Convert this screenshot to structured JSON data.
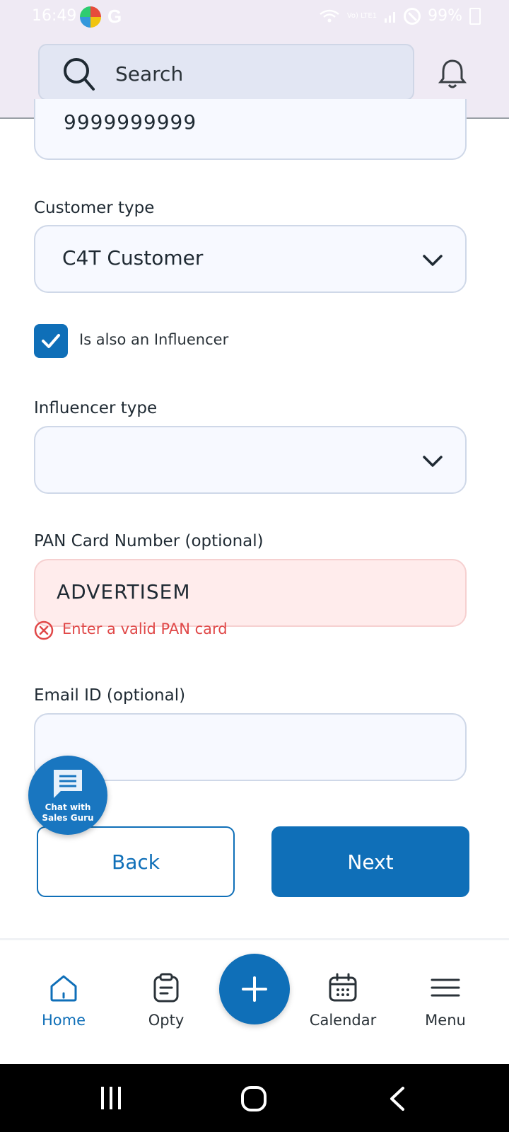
{
  "status_bar": {
    "time": "16:49",
    "network": "Vo) LTE1",
    "battery": "99%"
  },
  "header": {
    "search_placeholder": "Search"
  },
  "form": {
    "phone_value": "9999999999",
    "customer_type": {
      "label": "Customer type",
      "value": "C4T Customer"
    },
    "influencer_checkbox": {
      "label": "Is also an Influencer",
      "checked": true
    },
    "influencer_type": {
      "label": "Influencer type",
      "value": ""
    },
    "pan_card": {
      "label": "PAN Card Number (optional)",
      "value": "ADVERTISEM",
      "error": "Enter a valid PAN card"
    },
    "email": {
      "label": "Email ID (optional)",
      "value": ""
    }
  },
  "buttons": {
    "back": "Back",
    "next": "Next"
  },
  "chat_fab": {
    "line1": "Chat with",
    "line2": "Sales Guru"
  },
  "bottom_nav": {
    "items": [
      {
        "label": "Home",
        "icon": "home-icon",
        "active": true
      },
      {
        "label": "Opty",
        "icon": "clipboard-icon",
        "active": false
      },
      {
        "label": "Calendar",
        "icon": "calendar-icon",
        "active": false
      },
      {
        "label": "Menu",
        "icon": "hamburger-icon",
        "active": false
      }
    ]
  },
  "colors": {
    "primary": "#0f6fb8",
    "error": "#e04848",
    "header_bg": "#efeaf4"
  }
}
